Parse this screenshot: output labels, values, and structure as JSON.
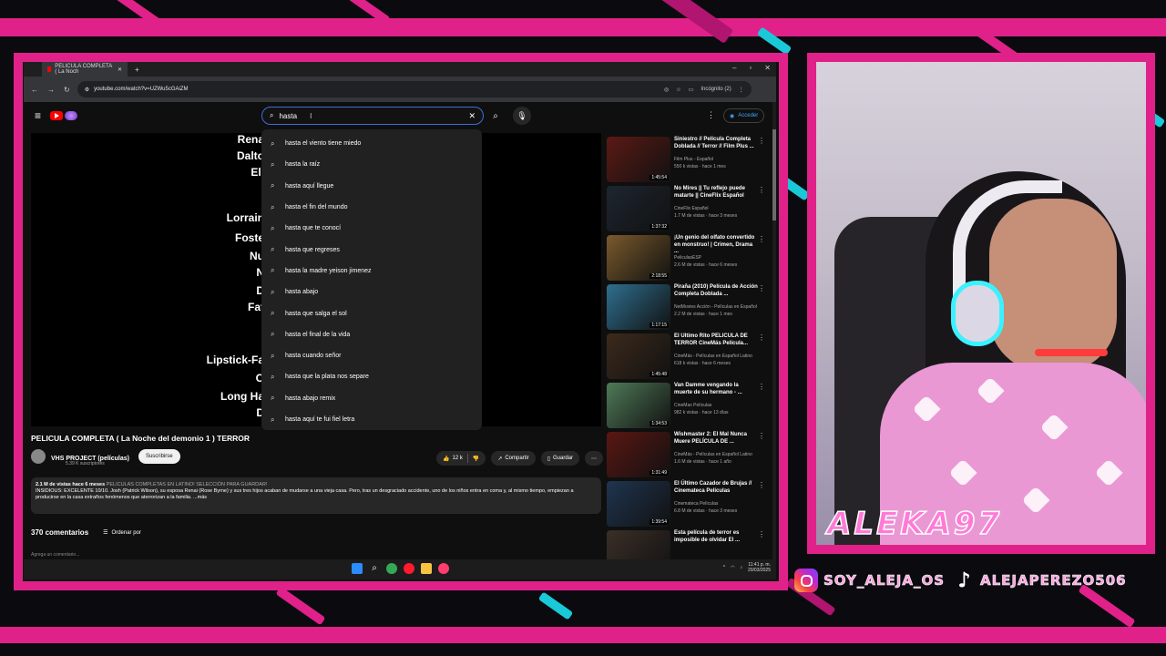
{
  "browser": {
    "tab_title": "PELICULA COMPLETA ( La Noch",
    "url": "youtube.com/watch?v=UZWu5cGAiZM",
    "incognito_label": "Incógnito (2)"
  },
  "youtube": {
    "search_query": "hasta",
    "account_label": "Acceder",
    "suggestions": [
      "hasta el viento tiene miedo",
      "hasta la raíz",
      "hasta aquí llegue",
      "hasta el fin del mundo",
      "hasta que te conocí",
      "hasta que regreses",
      "hasta la madre yeison jimenez",
      "hasta abajo",
      "hasta que salga el sol",
      "hasta el final de la vida",
      "hasta cuando señor",
      "hasta que la plata nos separe",
      "hasta abajo remix",
      "hasta aquí te fui fiel letra"
    ],
    "credits": [
      "Rena",
      "Dalto",
      "Eli",
      "Lorrain",
      "Foste",
      "Nu",
      "N",
      "D",
      "Fat",
      "Lipstick-Fa",
      "O",
      "Long Ha",
      "D"
    ],
    "video_title": "PELICULA COMPLETA ( La Noche del demonio 1 ) TERROR",
    "channel_name": "VHS PROJECT (películas)",
    "channel_subs": "5.39 K suscriptores",
    "subscribe_label": "Suscribirse",
    "like_count": "12 k",
    "share_label": "Compartir",
    "save_label": "Guardar",
    "desc_stats": "2.1 M de vistas  hace 6 meses",
    "desc_tags": "PELICULAS COMPLETAS EN LATINO! SELECCIÓN PARA GUARDAR!",
    "desc_text": "INSIDIOUS: EXCELENTE 10/10. Josh (Patrick Wilson), su esposa Renai (Rose Byrne) y sus tres hijos acaban de mudarse a una vieja casa. Pero, tras un desgraciado accidente, uno de los niños entra en coma y, al mismo tiempo, empiezan a producirse en la casa extraños fenómenos que aterrorizan a la familia. ...más",
    "comments_count": "370 comentarios",
    "sort_label": "Ordenar por",
    "add_comment": "Agrega un comentario..."
  },
  "recommendations": [
    {
      "title": "Siniestro // Película Completa Doblada // Terror // Film Plus ...",
      "channel": "Film Plus - Español",
      "meta": "550 k vistas · hace 1 mes",
      "duration": "1:45:54",
      "color": "#5b1a14"
    },
    {
      "title": "No Mires || Tu reflejo puede matarte || CineFlix Español",
      "channel": "CineFlix Español",
      "meta": "1.7 M de vistas · hace 3 meses",
      "duration": "1:37:32",
      "color": "#1d2630"
    },
    {
      "title": "¡Un genio del olfato convertido en monstruo! | Crimen, Drama ...",
      "channel": "PeliculasESP",
      "meta": "2.6 M de vistas · hace 6 meses",
      "duration": "2:18:55",
      "color": "#7a5a2c"
    },
    {
      "title": "Piraña (2010) Película de Acción Completa Doblada ...",
      "channel": "NetMovies Acción - Películas en Español",
      "meta": "2.2 M de vistas · hace 1 mes",
      "duration": "1:17:15",
      "color": "#2f6f8f"
    },
    {
      "title": "El Ultimo Rito PELICULA DE TERROR CineMás Película...",
      "channel": "CineMás - Películas en Español Latino",
      "meta": "618 k vistas · hace 6 meses",
      "duration": "1:45:48",
      "color": "#3c2a1c"
    },
    {
      "title": "Van Damme vengando la muerte de su hermano - ...",
      "channel": "CineMax Películas",
      "meta": "982 k vistas · hace 13 días",
      "duration": "1:34:53",
      "color": "#4f7a58"
    },
    {
      "title": "Wishmaster 2: El Mal Nunca Muere PELÍCULA DE ...",
      "channel": "CineMás - Películas en Español Latino",
      "meta": "1.6 M de vistas · hace 1 año",
      "duration": "1:31:49",
      "color": "#5a1712"
    },
    {
      "title": "El Último Cazador de Brujas // Cinemateca Películas",
      "channel": "Cinemateca Películas",
      "meta": "6.8 M de vistas · hace 3 meses",
      "duration": "1:39:54",
      "color": "#1f3550"
    },
    {
      "title": "Esta película de terror es imposible de olvidar El ...",
      "channel": "",
      "meta": "",
      "duration": "",
      "color": "#3b2f28"
    }
  ],
  "taskbar": {
    "time": "11:41 p. m.",
    "date": "20/03/2025"
  },
  "overlay": {
    "streamer_name": "ALEKA97",
    "instagram": "SOY_ALEJA_OS",
    "tiktok": "ALEJAPEREZO506",
    "accent": "#e0218a"
  }
}
